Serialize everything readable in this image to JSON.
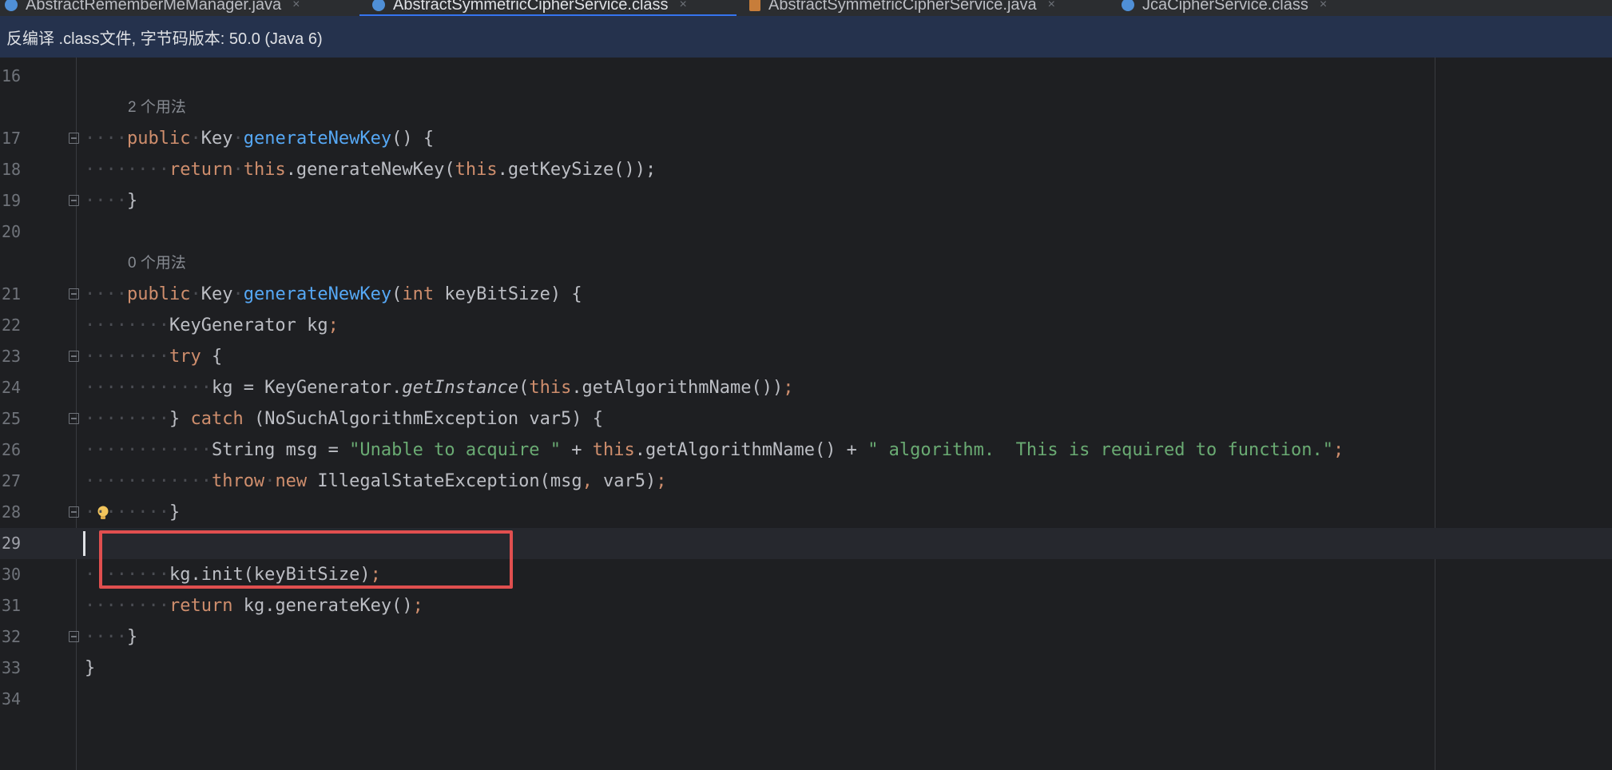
{
  "tabs": [
    {
      "label": "AbstractRememberMeManager.java",
      "type": "java",
      "active": false
    },
    {
      "label": "AbstractSymmetricCipherService.class",
      "type": "class",
      "active": true
    },
    {
      "label": "AbstractSymmetricCipherService.java",
      "type": "java",
      "active": false
    },
    {
      "label": "JcaCipherService.class",
      "type": "class",
      "active": false
    }
  ],
  "close_glyph": "×",
  "infobar": {
    "text": "反编译 .class文件, 字节码版本: 50.0 (Java 6)"
  },
  "colors": {
    "accent": "#3574f0",
    "highlight_box": "#e04f4f",
    "keyword": "#cf8e6d",
    "method": "#56a8f5",
    "string": "#6aab73"
  },
  "icons": {
    "fold": "fold-marker-icon",
    "bulb": "intention-bulb-icon",
    "tab_class": "class-file-icon",
    "tab_java": "java-file-icon"
  },
  "hints": {
    "usages_2": "2 个用法",
    "usages_0": "0 个用法"
  },
  "lines": [
    {
      "num": "16"
    },
    {
      "num": "17"
    },
    {
      "num": "18"
    },
    {
      "num": "19"
    },
    {
      "num": "20"
    },
    {
      "num": "21"
    },
    {
      "num": "22"
    },
    {
      "num": "23"
    },
    {
      "num": "24"
    },
    {
      "num": "25"
    },
    {
      "num": "26"
    },
    {
      "num": "27"
    },
    {
      "num": "28"
    },
    {
      "num": "29"
    },
    {
      "num": "30"
    },
    {
      "num": "31"
    },
    {
      "num": "32"
    },
    {
      "num": "33"
    },
    {
      "num": "34"
    }
  ],
  "code": {
    "l17_public": "public",
    "l17_type": "Key",
    "l17_name": "generateNewKey",
    "l17_rest": "() {",
    "l18_return": "return",
    "l18_this1": "this",
    "l18_mid": ".generateNewKey(",
    "l18_this2": "this",
    "l18_end": ".getKeySize());",
    "l19": "}",
    "l21_public": "public",
    "l21_type": "Key",
    "l21_name": "generateNewKey",
    "l21_open": "(",
    "l21_int": "int",
    "l21_rest": " keyBitSize) {",
    "l22": "KeyGenerator kg",
    "l22_semi": ";",
    "l23_try": "try",
    "l23_rest": " {",
    "l24_a": "kg = KeyGenerator.",
    "l24_it": "getInstance",
    "l24_b": "(",
    "l24_this": "this",
    "l24_c": ".getAlgorithmName())",
    "l24_semi": ";",
    "l25_a": "} ",
    "l25_catch": "catch",
    "l25_b": " (NoSuchAlgorithmException var5) {",
    "l26_a": "String msg = ",
    "l26_str1": "\"Unable to acquire \"",
    "l26_b": " + ",
    "l26_this": "this",
    "l26_c": ".getAlgorithmName() + ",
    "l26_str2": "\" algorithm.  This is required to function.\"",
    "l26_semi": ";",
    "l27_throw": "throw",
    "l27_new": "new",
    "l27_rest": " IllegalStateException(msg",
    "l27_comma": ",",
    "l27_end": " var5)",
    "l27_semi": ";",
    "l28": "}",
    "l30_a": "kg.init(keyBitSize)",
    "l30_semi": ";",
    "l31_return": "return",
    "l31_rest": " kg.generateKey()",
    "l31_semi": ";",
    "l32": "}",
    "l33": "}"
  }
}
